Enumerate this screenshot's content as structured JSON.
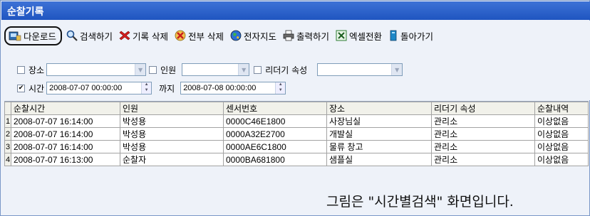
{
  "window": {
    "title": "순찰기록"
  },
  "toolbar": {
    "download": "다운로드",
    "search": "검색하기",
    "delete_record": "기록 삭제",
    "delete_all": "전부 삭제",
    "e_map": "전자지도",
    "print": "출력하기",
    "excel": "엑셀전환",
    "back": "돌아가기"
  },
  "filter": {
    "place_label": "장소",
    "place_checked": false,
    "person_label": "인원",
    "person_checked": false,
    "reader_attr_label": "리더기 속성",
    "reader_attr_checked": false,
    "time_label": "시간",
    "time_checked": true,
    "time_from": "2008-07-07 00:00:00",
    "until_label": "까지",
    "time_to": "2008-07-08 00:00:00"
  },
  "table": {
    "headers": [
      "순찰시간",
      "인원",
      "센서번호",
      "장소",
      "리더기 속성",
      "순찰내역"
    ],
    "rows": [
      {
        "n": "1",
        "time": "2008-07-07 16:14:00",
        "person": "박성용",
        "sensor": "0000C46E1800",
        "place": "사장님실",
        "reader": "관리소",
        "result": "이상없음"
      },
      {
        "n": "2",
        "time": "2008-07-07 16:14:00",
        "person": "박성용",
        "sensor": "0000A32E2700",
        "place": "개발실",
        "reader": "관리소",
        "result": "이상없음"
      },
      {
        "n": "3",
        "time": "2008-07-07 16:14:00",
        "person": "박성용",
        "sensor": "0000AE6C1800",
        "place": "물류 창고",
        "reader": "관리소",
        "result": "이상없음"
      },
      {
        "n": "4",
        "time": "2008-07-07 16:13:00",
        "person": "순찰자",
        "sensor": "0000BA681800",
        "place": "샘플실",
        "reader": "관리소",
        "result": "이상없음"
      }
    ]
  },
  "caption": "그림은 \"시간별검색\" 화면입니다.",
  "colors": {
    "titlebar": "#1f55c0",
    "window_bg": "#eef2f9",
    "grid_header": "#f1f1ea"
  },
  "icons": [
    "download-icon",
    "search-icon",
    "delete-record-icon",
    "delete-all-icon",
    "globe-icon",
    "printer-icon",
    "excel-icon",
    "back-icon"
  ]
}
